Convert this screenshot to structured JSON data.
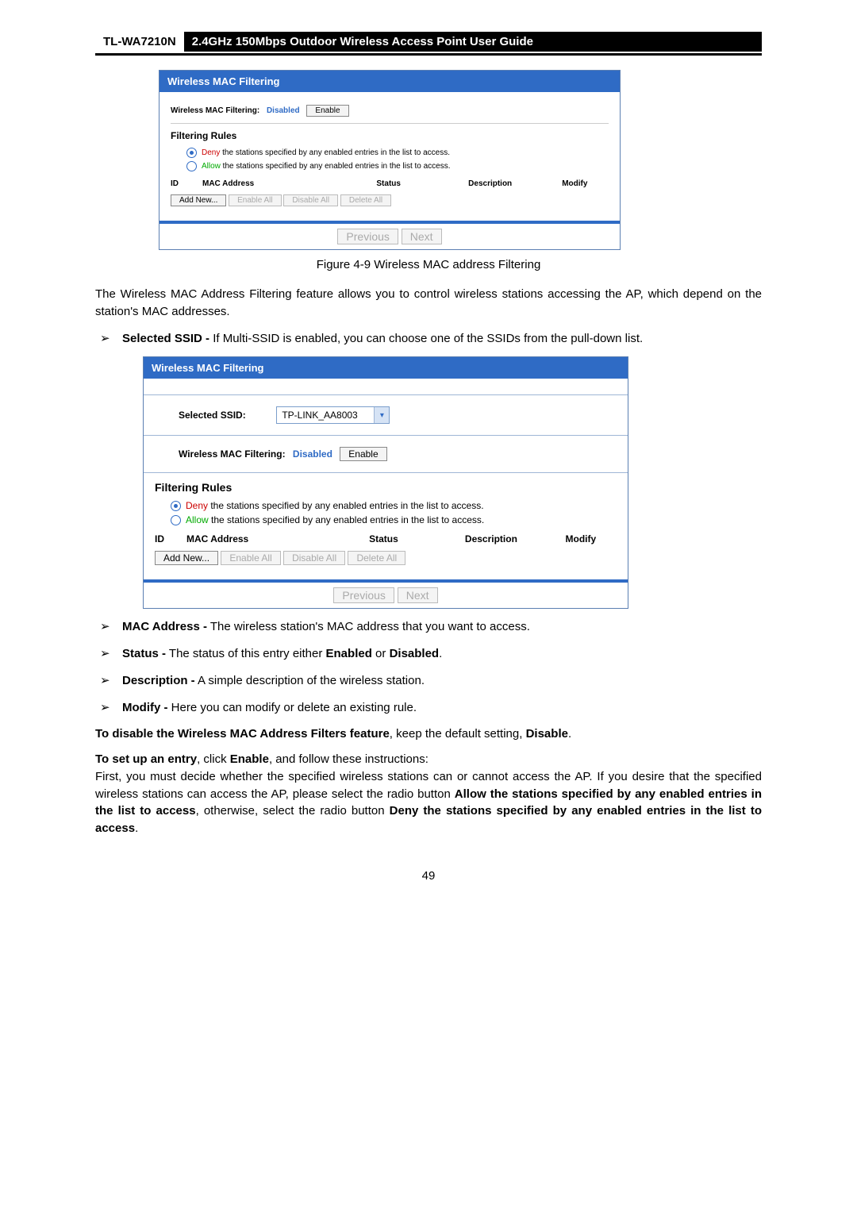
{
  "header": {
    "model": "TL-WA7210N",
    "title": "2.4GHz 150Mbps Outdoor Wireless Access Point User Guide"
  },
  "fig1": {
    "panel_title": "Wireless MAC Filtering",
    "filtering_label": "Wireless MAC Filtering:",
    "state": "Disabled",
    "enable_btn": "Enable",
    "rules_head": "Filtering Rules",
    "deny_word": "Deny",
    "allow_word": "Allow",
    "rule_suffix": " the stations specified by any enabled entries in the list to access.",
    "cols": {
      "id": "ID",
      "mac": "MAC Address",
      "status": "Status",
      "desc": "Description",
      "mod": "Modify"
    },
    "btns": {
      "add": "Add New...",
      "enable_all": "Enable All",
      "disable_all": "Disable All",
      "delete_all": "Delete All",
      "prev": "Previous",
      "next": "Next"
    },
    "caption": "Figure 4-9 Wireless MAC address Filtering"
  },
  "text": {
    "intro": "The Wireless MAC Address Filtering feature allows you to control wireless stations accessing the AP, which depend on the station's MAC addresses.",
    "ssid_item": {
      "lead": "Selected SSID -",
      "rest": " If Multi-SSID is enabled, you can choose one of the SSIDs from the pull-down list."
    }
  },
  "fig2": {
    "panel_title": "Wireless MAC Filtering",
    "ssid_label": "Selected SSID:",
    "ssid_value": "TP-LINK_AA8003",
    "filtering_label": "Wireless MAC Filtering:",
    "state": "Disabled",
    "enable_btn": "Enable",
    "rules_head": "Filtering Rules",
    "deny_word": "Deny",
    "allow_word": "Allow",
    "rule_suffix": " the stations specified by any enabled entries in the list to access.",
    "cols": {
      "id": "ID",
      "mac": "MAC Address",
      "status": "Status",
      "desc": "Description",
      "mod": "Modify"
    },
    "btns": {
      "add": "Add New...",
      "enable_all": "Enable All",
      "disable_all": "Disable All",
      "delete_all": "Delete All",
      "prev": "Previous",
      "next": "Next"
    }
  },
  "defs": {
    "mac": {
      "lead": "MAC Address -",
      "rest": " The wireless station's MAC address that you want to access."
    },
    "status": {
      "lead": "Status -",
      "mid": " The status of this entry either ",
      "b1": "Enabled",
      "or": " or ",
      "b2": "Disabled",
      "end": "."
    },
    "desc": {
      "lead": "Description -",
      "rest": " A simple description of the wireless station."
    },
    "mod": {
      "lead": "Modify -",
      "rest": " Here you can modify or delete an existing rule."
    }
  },
  "instr": {
    "disable": {
      "b1": "To disable the Wireless MAC Address Filters feature",
      "mid": ", keep the default setting, ",
      "b2": "Disable",
      "end": "."
    },
    "setup_lead": {
      "b1": "To set up an entry",
      "mid": ", click ",
      "b2": "Enable",
      "end": ", and follow these instructions:"
    },
    "setup_body": {
      "t1": "First, you must decide whether the specified wireless stations can or cannot access the AP. If you desire that the specified wireless stations can access the AP, please select the radio button ",
      "b1": "Allow the stations specified by any enabled entries in the list to access",
      "t2": ", otherwise, select the radio button ",
      "b2": "Deny the stations specified by any enabled entries in the list to access",
      "t3": "."
    }
  },
  "page_number": "49"
}
